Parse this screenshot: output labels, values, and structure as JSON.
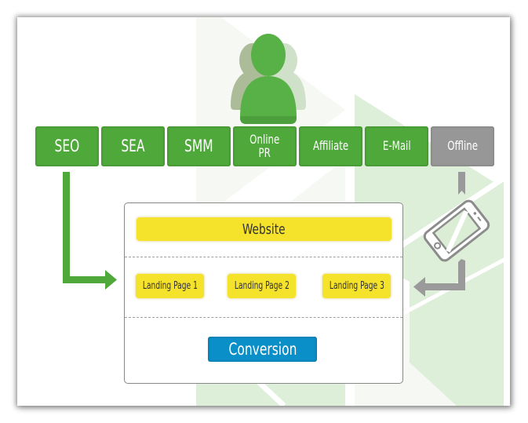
{
  "diagram": {
    "audience_icon": "users-group-icon",
    "channels": [
      {
        "id": "seo",
        "label": "SEO",
        "active": true
      },
      {
        "id": "sea",
        "label": "SEA",
        "active": true
      },
      {
        "id": "smm",
        "label": "SMM",
        "active": true
      },
      {
        "id": "online-pr",
        "label": "Online\nPR",
        "active": true
      },
      {
        "id": "affiliate",
        "label": "Affiliate",
        "active": true
      },
      {
        "id": "email",
        "label": "E-Mail",
        "active": true
      },
      {
        "id": "offline",
        "label": "Offline",
        "active": false
      }
    ],
    "website": {
      "title": "Website",
      "landing_pages": [
        "Landing Page 1",
        "Landing Page 2",
        "Landing Page 3"
      ],
      "conversion": "Conversion"
    },
    "offline_device_icon": "smartphone-icon",
    "colors": {
      "channel_green": "#4ea83a",
      "channel_gray": "#979797",
      "website_yellow": "#f5e22a",
      "conversion_blue": "#0a8fc9",
      "user_green": "#58b146",
      "arrow_green": "#4ea83a",
      "arrow_gray": "#9a9a9a",
      "bg_light_green": "#ddeed9",
      "bg_pale": "#f5f8f3"
    }
  }
}
